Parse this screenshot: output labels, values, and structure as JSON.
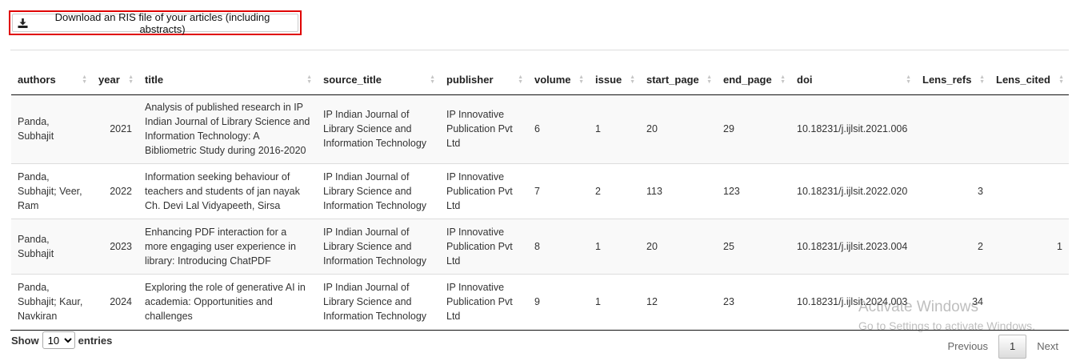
{
  "download_button": {
    "label": "Download an RIS file of your articles (including abstracts)",
    "icon": "download-icon"
  },
  "table": {
    "columns": [
      "authors",
      "year",
      "title",
      "source_title",
      "publisher",
      "volume",
      "issue",
      "start_page",
      "end_page",
      "doi",
      "Lens_refs",
      "Lens_cited"
    ],
    "rows": [
      {
        "authors": "Panda, Subhajit",
        "year": "2021",
        "title": "Analysis of published research in IP Indian Journal of Library Science and Information Technology: A Bibliometric Study during 2016-2020",
        "source_title": "IP Indian Journal of Library Science and Information Technology",
        "publisher": "IP Innovative Publication Pvt Ltd",
        "volume": "6",
        "issue": "1",
        "start_page": "20",
        "end_page": "29",
        "doi": "10.18231/j.ijlsit.2021.006",
        "Lens_refs": "",
        "Lens_cited": ""
      },
      {
        "authors": "Panda, Subhajit; Veer, Ram",
        "year": "2022",
        "title": "Information seeking behaviour of teachers and students of jan nayak Ch. Devi Lal Vidyapeeth, Sirsa",
        "source_title": "IP Indian Journal of Library Science and Information Technology",
        "publisher": "IP Innovative Publication Pvt Ltd",
        "volume": "7",
        "issue": "2",
        "start_page": "113",
        "end_page": "123",
        "doi": "10.18231/j.ijlsit.2022.020",
        "Lens_refs": "3",
        "Lens_cited": ""
      },
      {
        "authors": "Panda, Subhajit",
        "year": "2023",
        "title": "Enhancing PDF interaction for a more engaging user experience in library: Introducing ChatPDF",
        "source_title": "IP Indian Journal of Library Science and Information Technology",
        "publisher": "IP Innovative Publication Pvt Ltd",
        "volume": "8",
        "issue": "1",
        "start_page": "20",
        "end_page": "25",
        "doi": "10.18231/j.ijlsit.2023.004",
        "Lens_refs": "2",
        "Lens_cited": "1"
      },
      {
        "authors": "Panda, Subhajit; Kaur, Navkiran",
        "year": "2024",
        "title": "Exploring the role of generative AI in academia: Opportunities and challenges",
        "source_title": "IP Indian Journal of Library Science and Information Technology",
        "publisher": "IP Innovative Publication Pvt Ltd",
        "volume": "9",
        "issue": "1",
        "start_page": "12",
        "end_page": "23",
        "doi": "10.18231/j.ijlsit.2024.003",
        "Lens_refs": "34",
        "Lens_cited": ""
      }
    ]
  },
  "length_menu": {
    "show_label": "Show",
    "selected": "10",
    "entries_label": "entries"
  },
  "pagination": {
    "previous": "Previous",
    "current": "1",
    "next": "Next"
  },
  "watermark": {
    "line1": "Activate Windows",
    "line2": "Go to Settings to activate Windows."
  },
  "colors": {
    "highlight_border": "#e00000",
    "stripe": "#f9f9f9"
  }
}
